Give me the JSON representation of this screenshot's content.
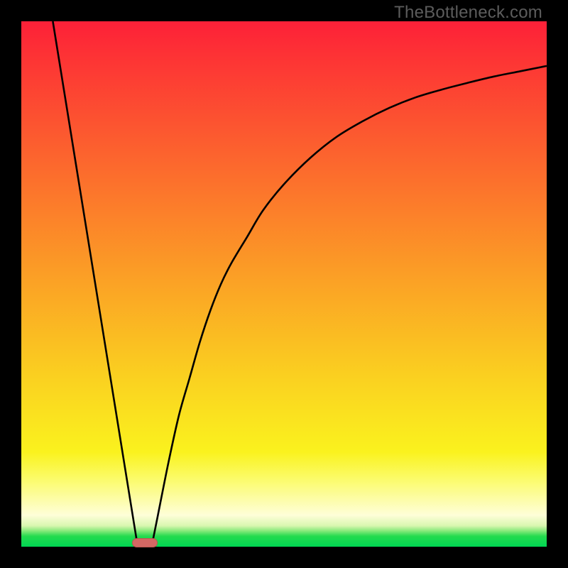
{
  "watermark_text": "TheBottleneck.com",
  "chart_data": {
    "type": "line",
    "title": "",
    "xlabel": "",
    "ylabel": "",
    "xlim": [
      0,
      100
    ],
    "ylim": [
      0,
      100
    ],
    "grid": false,
    "legend": false,
    "series": [
      {
        "name": "left-line",
        "x": [
          6,
          22
        ],
        "y": [
          100,
          1
        ]
      },
      {
        "name": "right-curve",
        "x": [
          25,
          26,
          28,
          30,
          32,
          34,
          36,
          38,
          40,
          43,
          46,
          50,
          55,
          60,
          65,
          70,
          75,
          80,
          85,
          90,
          95,
          100
        ],
        "y": [
          1,
          6,
          16,
          25,
          32,
          39,
          45,
          50,
          54,
          59,
          64,
          69,
          74,
          78,
          81,
          83.5,
          85.5,
          87,
          88.3,
          89.5,
          90.5,
          91.5
        ]
      }
    ],
    "marker": {
      "name": "min-marker",
      "x": 23.5,
      "y": 0.8,
      "color": "#d46864"
    },
    "gradient_stops": [
      {
        "pos": 0,
        "color": "#fd2038"
      },
      {
        "pos": 50,
        "color": "#fba325"
      },
      {
        "pos": 82,
        "color": "#faf21e"
      },
      {
        "pos": 100,
        "color": "#00d653"
      }
    ]
  }
}
